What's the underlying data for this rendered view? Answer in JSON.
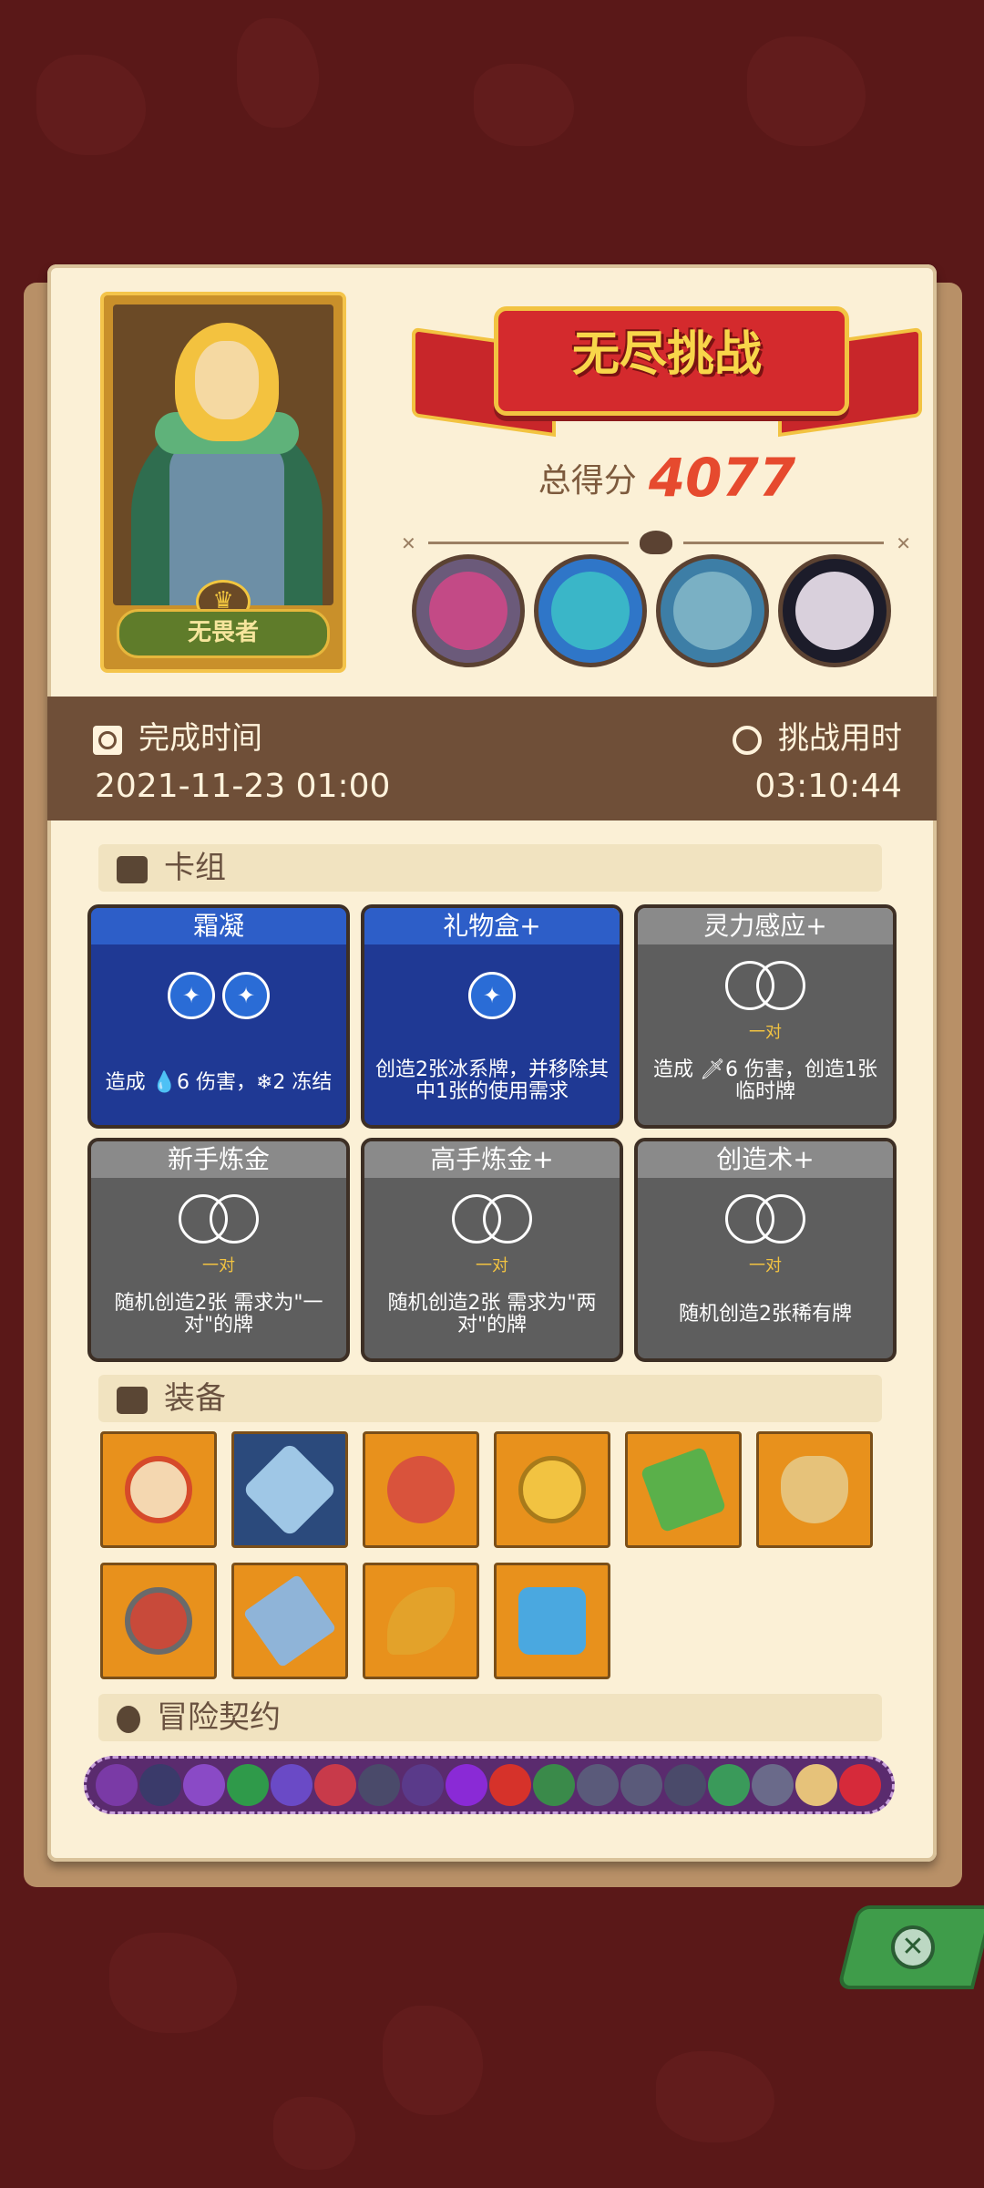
{
  "hero": {
    "name": "无畏者"
  },
  "banner": {
    "title": "无尽挑战"
  },
  "score": {
    "label": "总得分",
    "value": "4077"
  },
  "bosses": [
    "boss-1",
    "boss-2",
    "boss-3",
    "boss-4"
  ],
  "times": {
    "completed_label": "完成时间",
    "completed_value": "2021-11-23 01:00",
    "duration_label": "挑战用时",
    "duration_value": "03:10:44"
  },
  "deck": {
    "header": "卡组",
    "cards": [
      {
        "title": "霜凝",
        "style": "blue",
        "desc": "造成 💧6 伤害，❄2 冻结",
        "sub": ""
      },
      {
        "title": "礼物盒+",
        "style": "blue",
        "desc": "创造2张冰系牌，并移除其中1张的使用需求",
        "sub": ""
      },
      {
        "title": "灵力感应+",
        "style": "gray",
        "desc": "造成 🗡6 伤害，创造1张临时牌",
        "sub": "一对"
      },
      {
        "title": "新手炼金",
        "style": "gray",
        "desc": "随机创造2张 需求为\"一对\"的牌",
        "sub": "一对"
      },
      {
        "title": "高手炼金+",
        "style": "gray",
        "desc": "随机创造2张 需求为\"两对\"的牌",
        "sub": "一对"
      },
      {
        "title": "创造术+",
        "style": "gray",
        "desc": "随机创造2张稀有牌",
        "sub": "一对"
      }
    ]
  },
  "equipment": {
    "header": "装备",
    "items": [
      "shield-icon",
      "snowflake-icon",
      "meat-icon",
      "coin-icon",
      "slab-icon",
      "bag-icon",
      "gear-icon",
      "blade-icon",
      "feather-icon",
      "crystal-icon"
    ]
  },
  "contract": {
    "header": "冒险契约"
  },
  "close": {
    "icon": "close-icon"
  },
  "colors": {
    "score": "#e64a2e",
    "panel": "#fbf0d6",
    "timebar": "#6f4f38",
    "close": "#3f9c4a"
  }
}
